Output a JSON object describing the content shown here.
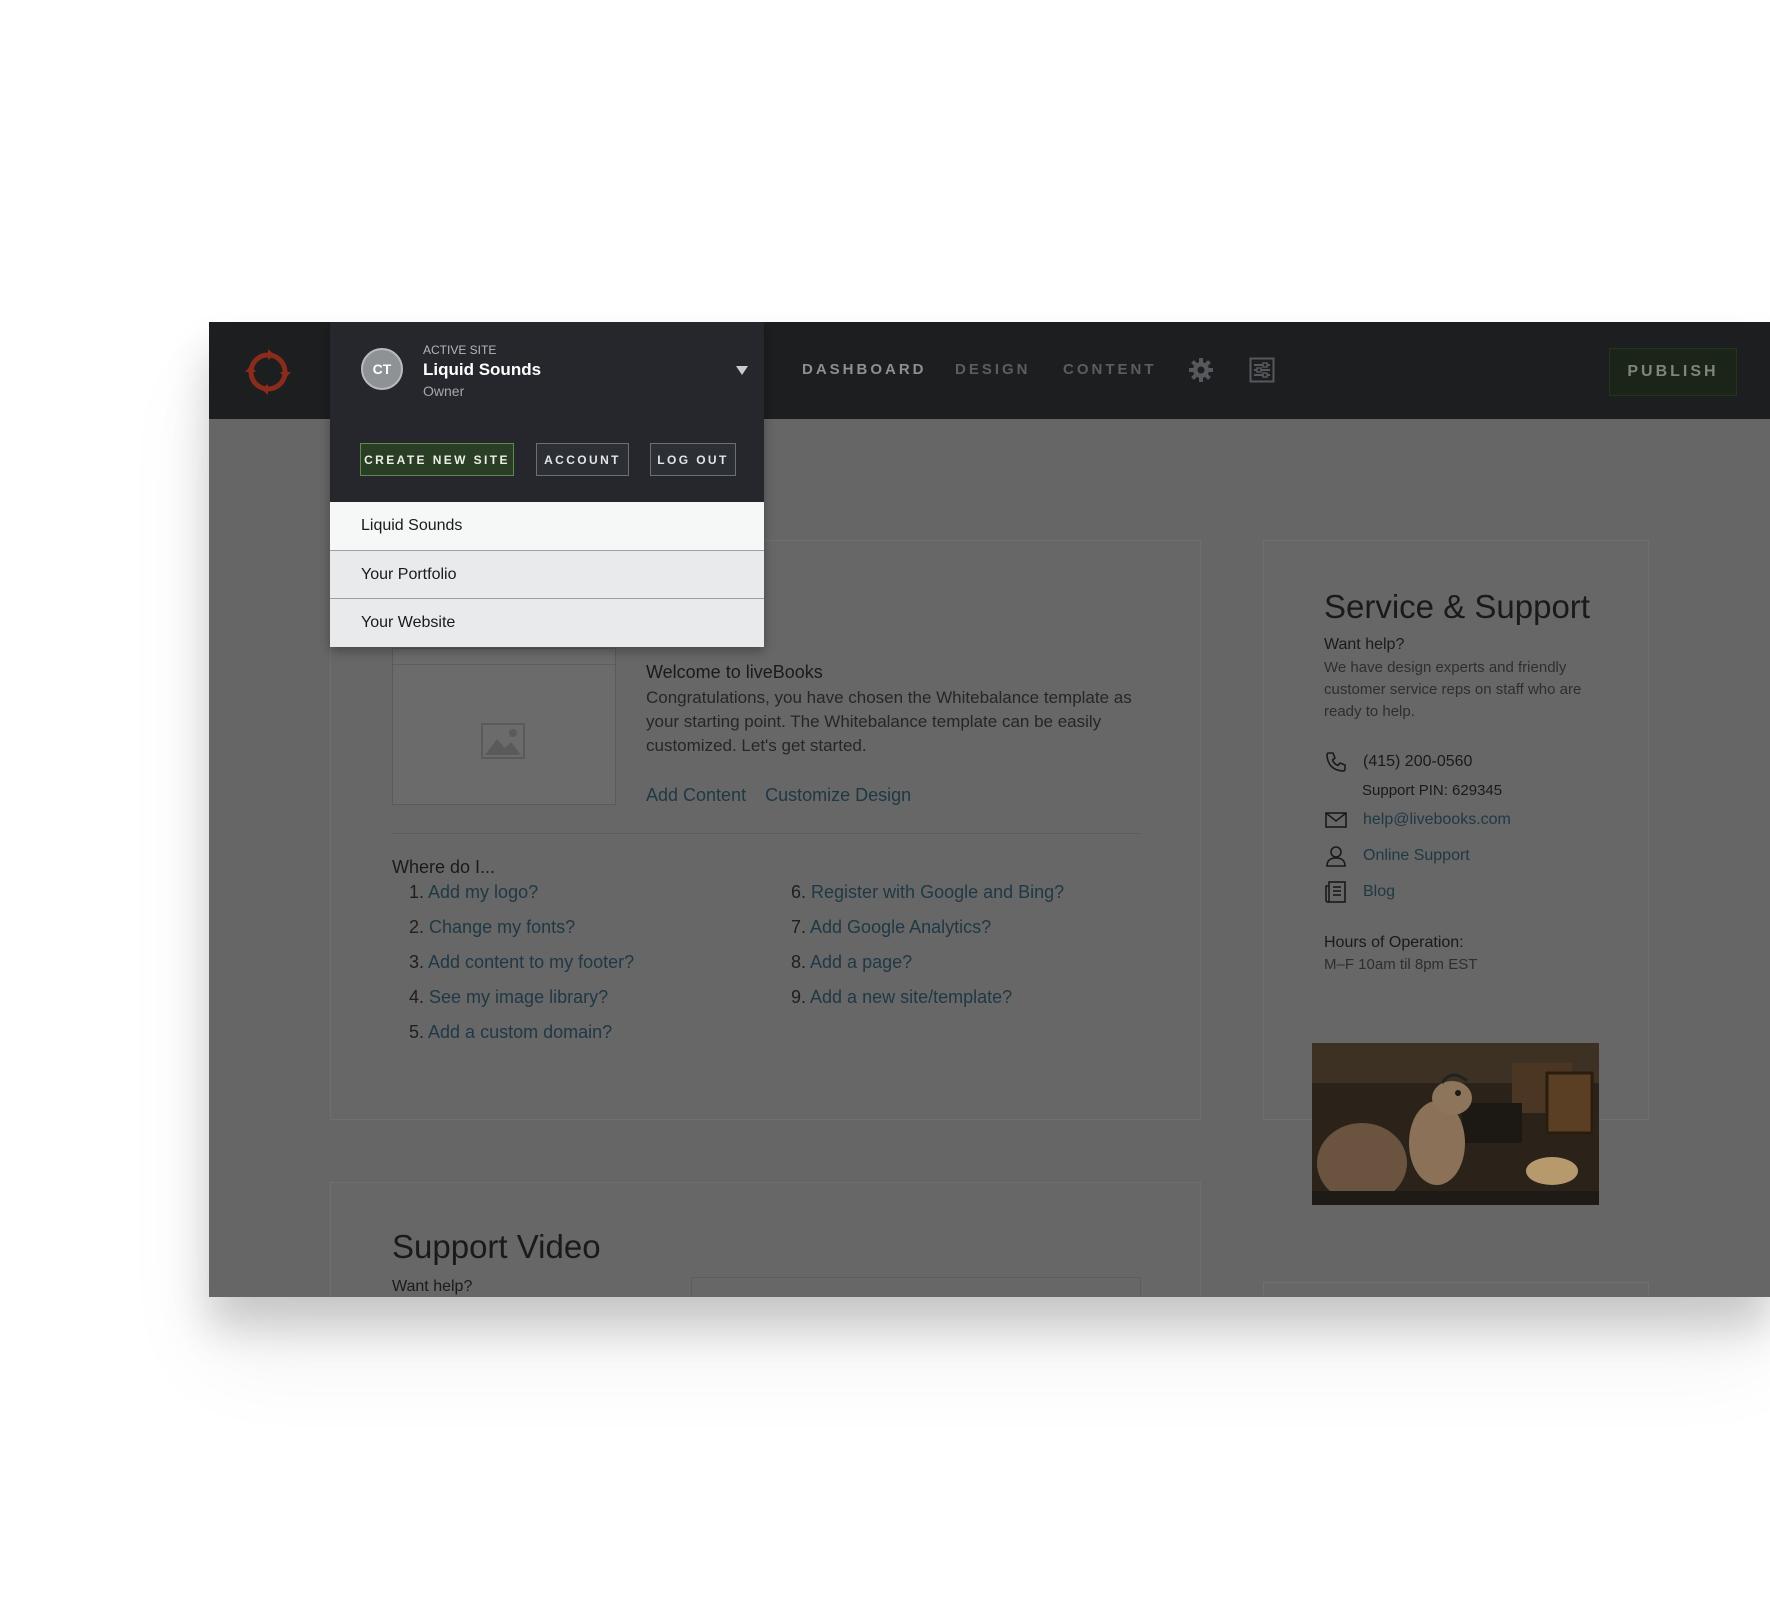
{
  "topbar": {
    "nav": [
      {
        "label": "DASHBOARD"
      },
      {
        "label": "DESIGN"
      },
      {
        "label": "CONTENT"
      }
    ],
    "publish_label": "PUBLISH"
  },
  "dropdown": {
    "avatar_initials": "CT",
    "active_label": "ACTIVE SITE",
    "active_name": "Liquid Sounds",
    "active_role": "Owner",
    "buttons": {
      "create": "CREATE NEW SITE",
      "account": "ACCOUNT",
      "logout": "LOG OUT"
    },
    "sites": [
      "Liquid Sounds",
      "Your Portfolio",
      "Your Website"
    ]
  },
  "welcome": {
    "title": "Welcome to liveBooks",
    "text": "Congratulations, you have chosen the Whitebalance template as your starting point. The Whitebalance template can be easily customized. Let's get started.",
    "links": {
      "add_content": "Add Content",
      "customize": "Customize Design"
    }
  },
  "faq": {
    "heading": "Where do I...",
    "left": [
      {
        "num": "1.",
        "text": "Add my logo?"
      },
      {
        "num": "2.",
        "text": "Change my fonts?"
      },
      {
        "num": "3.",
        "text": "Add content to my footer?"
      },
      {
        "num": "4.",
        "text": "See my image library?"
      },
      {
        "num": "5.",
        "text": "Add a custom domain?"
      }
    ],
    "right": [
      {
        "num": "6.",
        "text": "Register with Google and Bing?"
      },
      {
        "num": "7.",
        "text": "Add Google Analytics?"
      },
      {
        "num": "8.",
        "text": "Add a page?"
      },
      {
        "num": "9.",
        "text": "Add a new site/template?"
      }
    ]
  },
  "support": {
    "title": "Service & Support",
    "want_help": "Want help?",
    "description": "We have design experts and friendly customer service reps on staff who are ready to help.",
    "phone": "(415) 200-0560",
    "pin": "Support PIN: 629345",
    "email": "help@livebooks.com",
    "online": "Online Support",
    "blog": "Blog",
    "hours_title": "Hours of Operation:",
    "hours": "M–F 10am til 8pm EST"
  },
  "video": {
    "title": "Support Video",
    "want_help": "Want help?"
  },
  "colors": {
    "accent_green": "#2a3d25",
    "link": "#203845",
    "topbar": "#1d1e20",
    "logo": "#8a2b1c"
  }
}
